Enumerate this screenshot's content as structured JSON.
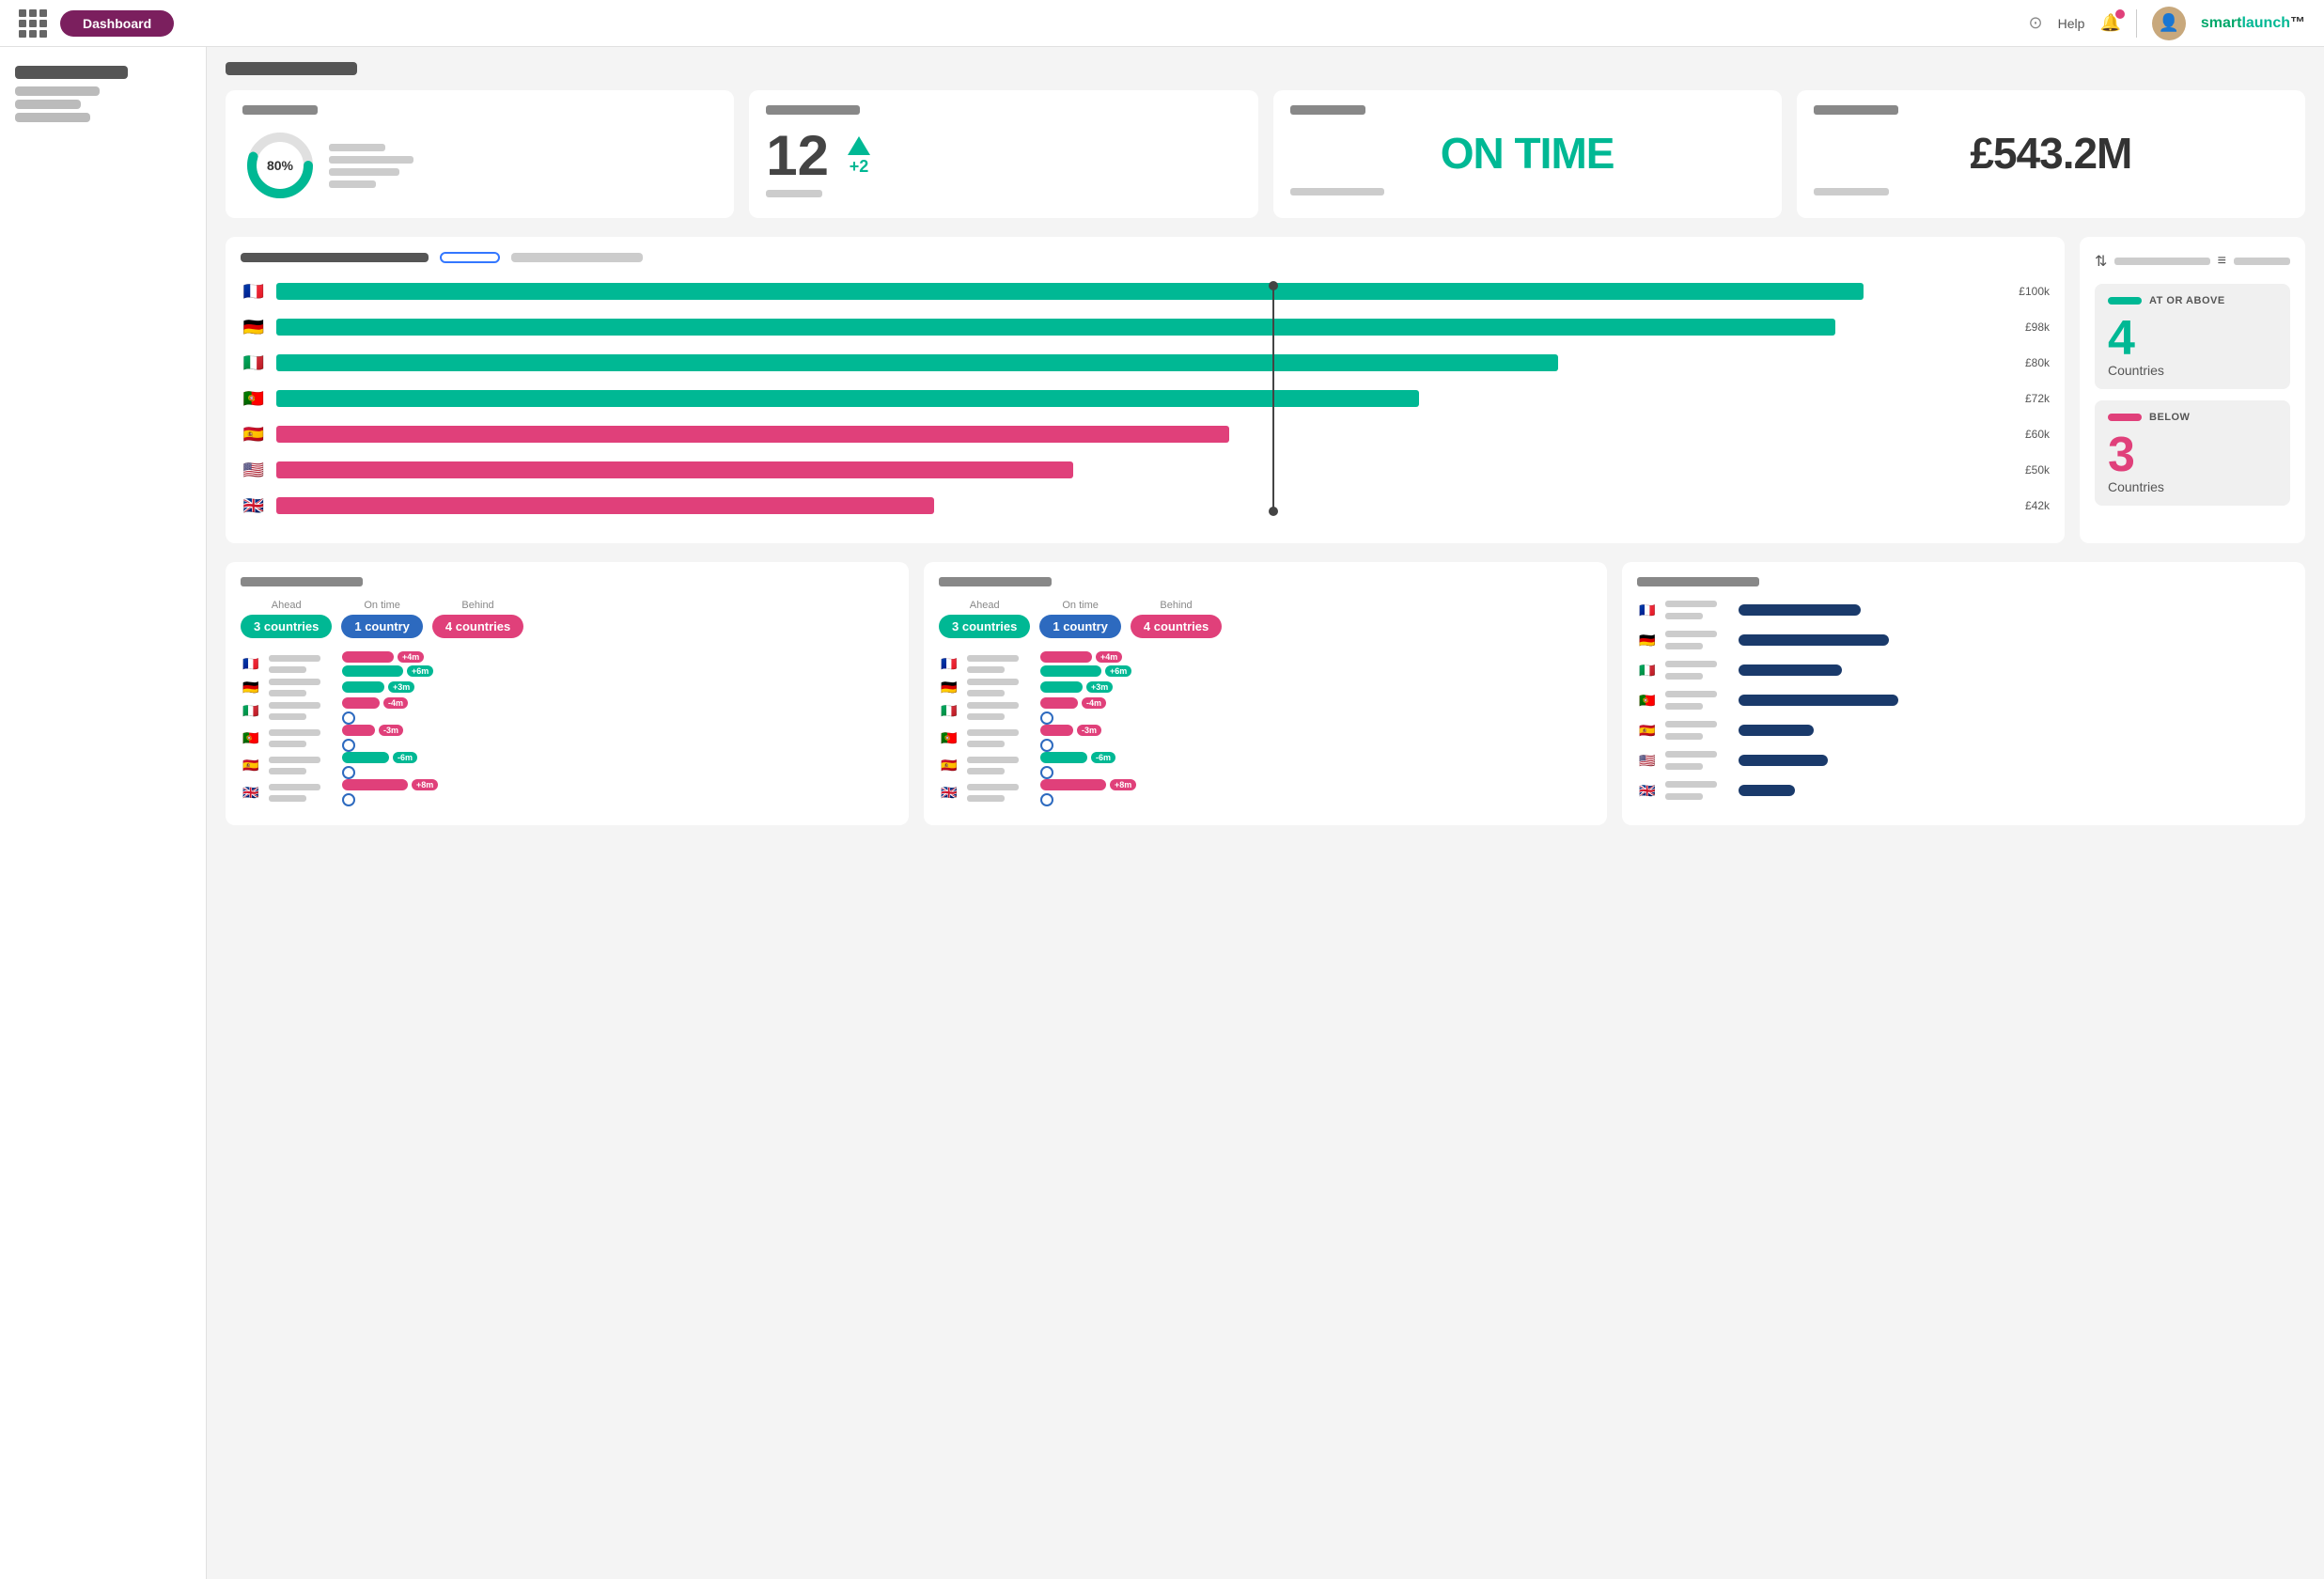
{
  "nav": {
    "brand": "smart",
    "brand_highlight": "launch",
    "help_label": "Help",
    "pill_label": "Dashboard"
  },
  "sidebar": {
    "title_width": 120,
    "lines": [
      90,
      70,
      80
    ]
  },
  "page": {
    "heading_width": 140,
    "sub_heading_width": 110
  },
  "metrics": [
    {
      "label_width": 80,
      "type": "donut",
      "value": "80%",
      "lines": [
        60,
        90,
        75,
        50
      ]
    },
    {
      "label_width": 100,
      "type": "number",
      "big": "12",
      "arrow": "+2"
    },
    {
      "label_width": 80,
      "type": "ontime",
      "text": "ON TIME"
    },
    {
      "label_width": 90,
      "type": "revenue",
      "text": "£543.2M"
    }
  ],
  "chart": {
    "ctrl_bar_width": 180,
    "pill_label": "",
    "vline_pct": 62,
    "bars": [
      {
        "flag": "🇫🇷",
        "color": "#00b894",
        "width_pct": 92,
        "label": "£100k"
      },
      {
        "flag": "🇩🇪",
        "color": "#00b894",
        "width_pct": 90,
        "label": "£98k"
      },
      {
        "flag": "🇮🇹",
        "color": "#00b894",
        "width_pct": 74,
        "label": "£80k"
      },
      {
        "flag": "🇵🇹",
        "color": "#00b894",
        "width_pct": 66,
        "label": "£72k"
      },
      {
        "flag": "🇪🇸",
        "color": "#e0407a",
        "width_pct": 55,
        "label": "£60k"
      },
      {
        "flag": "🇺🇸",
        "color": "#e0407a",
        "width_pct": 46,
        "label": "£50k"
      },
      {
        "flag": "🇬🇧",
        "color": "#e0407a",
        "width_pct": 38,
        "label": "£42k"
      }
    ]
  },
  "legend": {
    "above": {
      "color": "#00b894",
      "label": "AT OR ABOVE",
      "num": "4",
      "sub": "Countries"
    },
    "below": {
      "color": "#e0407a",
      "label": "BELOW",
      "num": "3",
      "sub": "Countries"
    }
  },
  "panels": [
    {
      "title_width": 130,
      "ahead_label": "Ahead",
      "ontime_label": "On time",
      "behind_label": "Behind",
      "ahead_count": "3",
      "ahead_unit": "countries",
      "ontime_count": "1",
      "ontime_unit": "country",
      "behind_count": "4",
      "behind_unit": "countries",
      "countries": [
        {
          "flag": "🇫🇷",
          "bars": [
            {
              "color": "#e0407a",
              "w": 55,
              "tag": "+4m",
              "tag_color": "tag-pink"
            },
            {
              "color": "#00b894",
              "w": 65,
              "tag": "+6m",
              "tag_color": "tag-teal"
            }
          ]
        },
        {
          "flag": "🇩🇪",
          "bars": [
            {
              "color": "#00b894",
              "w": 45,
              "tag": "+3m",
              "tag_color": "tag-teal"
            }
          ]
        },
        {
          "flag": "🇮🇹",
          "bars": [
            {
              "color": "#e0407a",
              "w": 40,
              "tag": "-4m",
              "tag_color": "tag-pink"
            },
            {
              "toggle": true
            }
          ]
        },
        {
          "flag": "🇵🇹",
          "bars": [
            {
              "color": "#e0407a",
              "w": 35,
              "tag": "-3m",
              "tag_color": "tag-pink"
            },
            {
              "toggle": true
            }
          ]
        },
        {
          "flag": "🇪🇸",
          "bars": [
            {
              "color": "#00b894",
              "w": 50,
              "tag": "-6m",
              "tag_color": "tag-teal"
            },
            {
              "toggle": true
            }
          ]
        },
        {
          "flag": "🇬🇧",
          "bars": [
            {
              "color": "#e0407a",
              "w": 70,
              "tag": "+8m",
              "tag_color": "tag-pink"
            },
            {
              "toggle": true
            }
          ]
        }
      ]
    },
    {
      "title_width": 120,
      "ahead_label": "Ahead",
      "ontime_label": "On time",
      "behind_label": "Behind",
      "ahead_count": "3",
      "ahead_unit": "countries",
      "ontime_count": "1",
      "ontime_unit": "country",
      "behind_count": "4",
      "behind_unit": "countries",
      "countries": [
        {
          "flag": "🇫🇷",
          "bars": [
            {
              "color": "#e0407a",
              "w": 55,
              "tag": "+4m",
              "tag_color": "tag-pink"
            },
            {
              "color": "#00b894",
              "w": 65,
              "tag": "+6m",
              "tag_color": "tag-teal"
            }
          ]
        },
        {
          "flag": "🇩🇪",
          "bars": [
            {
              "color": "#00b894",
              "w": 45,
              "tag": "+3m",
              "tag_color": "tag-teal"
            }
          ]
        },
        {
          "flag": "🇮🇹",
          "bars": [
            {
              "color": "#e0407a",
              "w": 40,
              "tag": "-4m",
              "tag_color": "tag-pink"
            },
            {
              "toggle": true
            }
          ]
        },
        {
          "flag": "🇵🇹",
          "bars": [
            {
              "color": "#e0407a",
              "w": 35,
              "tag": "-3m",
              "tag_color": "tag-pink"
            },
            {
              "toggle": true
            }
          ]
        },
        {
          "flag": "🇪🇸",
          "bars": [
            {
              "color": "#00b894",
              "w": 50,
              "tag": "-6m",
              "tag_color": "tag-teal"
            },
            {
              "toggle": true
            }
          ]
        },
        {
          "flag": "🇬🇧",
          "bars": [
            {
              "color": "#e0407a",
              "w": 70,
              "tag": "+8m",
              "tag_color": "tag-pink"
            },
            {
              "toggle": true
            }
          ]
        }
      ]
    },
    {
      "title_width": 130,
      "type": "bars_only",
      "countries": [
        {
          "flag": "🇫🇷",
          "bar_widths": [
            130,
            0
          ]
        },
        {
          "flag": "🇩🇪",
          "bar_widths": [
            160,
            0
          ]
        },
        {
          "flag": "🇮🇹",
          "bar_widths": [
            110,
            0
          ]
        },
        {
          "flag": "🇵🇹",
          "bar_widths": [
            170,
            0
          ]
        },
        {
          "flag": "🇪🇸",
          "bar_widths": [
            80,
            0
          ]
        },
        {
          "flag": "🇺🇸",
          "bar_widths": [
            95,
            0
          ]
        },
        {
          "flag": "🇬🇧",
          "bar_widths": [
            60,
            0
          ]
        }
      ]
    }
  ]
}
